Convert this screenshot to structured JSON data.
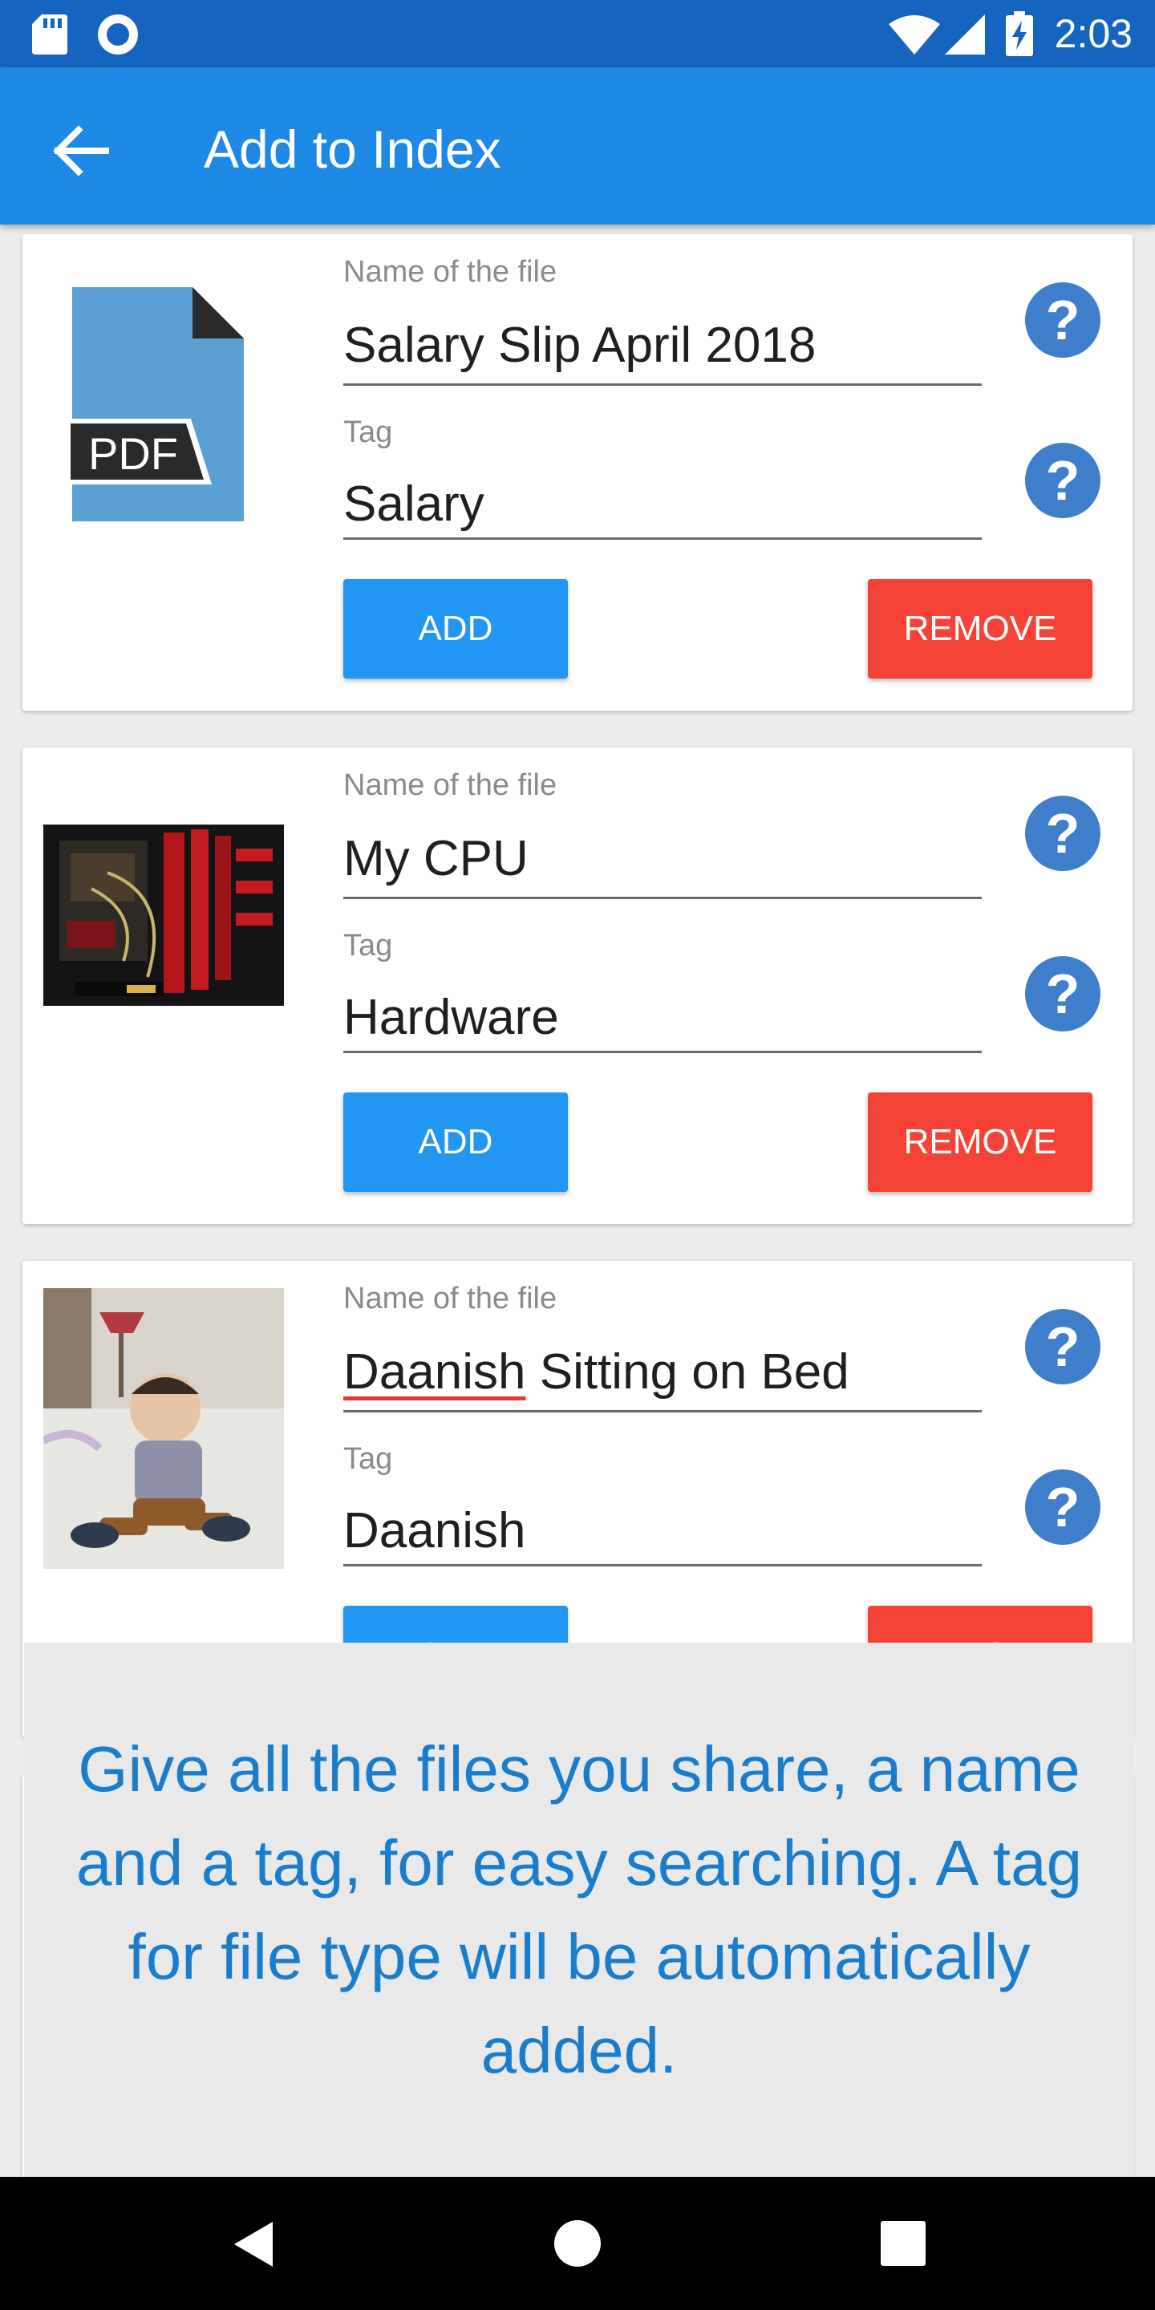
{
  "status_bar": {
    "time": "2:03",
    "icons": [
      "sd-card-icon",
      "record-icon",
      "wifi-icon",
      "signal-icon",
      "battery-charging-icon"
    ]
  },
  "app_bar": {
    "title": "Add to Index",
    "back_icon": "arrow-back-icon"
  },
  "items": [
    {
      "thumbnail": "pdf-file-icon",
      "thumbnail_badge": "PDF",
      "name_label": "Name of the file",
      "name_value": "Salary Slip April 2018",
      "tag_label": "Tag",
      "tag_value": "Salary",
      "add_label": "ADD",
      "remove_label": "REMOVE"
    },
    {
      "thumbnail": "cpu-photo",
      "name_label": "Name of the file",
      "name_value": "My CPU",
      "tag_label": "Tag",
      "tag_value": "Hardware",
      "add_label": "ADD",
      "remove_label": "REMOVE"
    },
    {
      "thumbnail": "baby-photo",
      "name_label": "Name of the file",
      "name_value_underlined": "Daanish",
      "name_value_rest": " Sitting on Bed",
      "tag_label": "Tag",
      "tag_value": "Daanish",
      "add_label": "ADD",
      "remove_label": "REMOVE"
    }
  ],
  "help_icon_text": "?",
  "tooltip": {
    "text": "Give all the files you share, a name and a tag, for easy searching. A tag for file type will be automatically added."
  },
  "nav_bar": {
    "icons": [
      "nav-back-icon",
      "nav-home-icon",
      "nav-recents-icon"
    ]
  },
  "colors": {
    "status_bar": "#1565c0",
    "app_bar": "#1e88e5",
    "add_button": "#2196f3",
    "remove_button": "#f44336",
    "help_icon": "#3f7ecb",
    "tooltip_text": "#1a7dcc"
  }
}
